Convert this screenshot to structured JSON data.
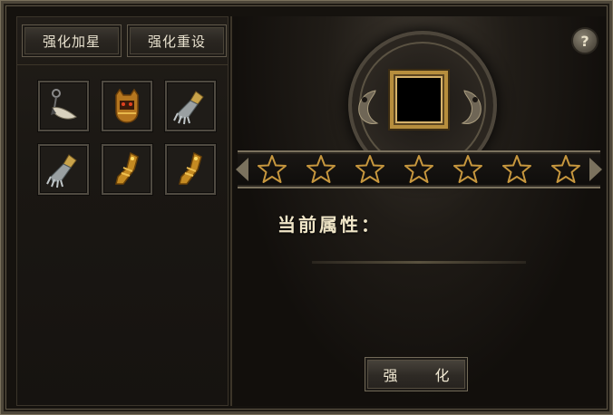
{
  "tabs": {
    "enhance_star": "强化加星",
    "enhance_reset": "强化重设"
  },
  "equipment_slots": [
    {
      "icon": "claw-necklace-icon"
    },
    {
      "icon": "golden-helmet-icon"
    },
    {
      "icon": "gauntlet-icon"
    },
    {
      "icon": "gauntlet-icon"
    },
    {
      "icon": "golden-boot-icon"
    },
    {
      "icon": "golden-boot-icon"
    }
  ],
  "help": {
    "label": "?"
  },
  "stars": {
    "total": 7,
    "filled": 0
  },
  "attributes": {
    "label": "当前属性："
  },
  "actions": {
    "enhance_label": "强 化"
  },
  "colors": {
    "gold": "#b78e3d",
    "panel": "#1a1713",
    "text": "#f0e6c8"
  }
}
